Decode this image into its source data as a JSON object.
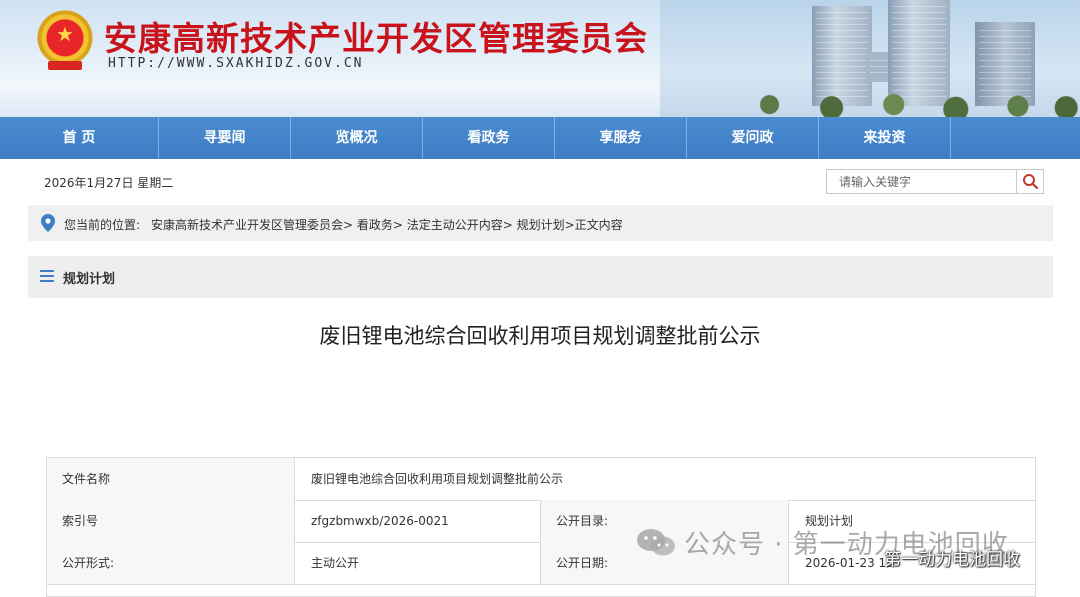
{
  "header": {
    "title": "安康高新技术产业开发区管理委员会",
    "url": "HTTP://WWW.SXAKHIDZ.GOV.CN"
  },
  "nav": {
    "items": [
      {
        "label": "首 页"
      },
      {
        "label": "寻要闻"
      },
      {
        "label": "览概况"
      },
      {
        "label": "看政务"
      },
      {
        "label": "享服务"
      },
      {
        "label": "爱问政"
      },
      {
        "label": "来投资"
      }
    ]
  },
  "topbar": {
    "date": "2026年1月27日 星期二",
    "search_placeholder": "请输入关键字"
  },
  "breadcrumb": {
    "label": "您当前的位置:",
    "path": "安康高新技术产业开发区管理委员会> 看政务> 法定主动公开内容> 规划计划>正文内容"
  },
  "section": {
    "title": "规划计划"
  },
  "article": {
    "title": "废旧锂电池综合回收利用项目规划调整批前公示"
  },
  "meta": {
    "doc_name_key": "文件名称",
    "doc_name_value": "废旧锂电池综合回收利用项目规划调整批前公示",
    "index_key": "索引号",
    "index_value": "zfgzbmwxb/2026-0021",
    "catalog_key": "公开目录:",
    "catalog_value": "规划计划",
    "form_key": "公开形式:",
    "form_value": "主动公开",
    "date_key": "公开日期:",
    "date_value": "2026-01-23 15:"
  },
  "watermark": {
    "main": "公众号 · 第一动力电池回收",
    "corner": "第一动力电池回收"
  },
  "colors": {
    "nav_blue": "#3f7dc4",
    "title_red": "#c8131b"
  }
}
